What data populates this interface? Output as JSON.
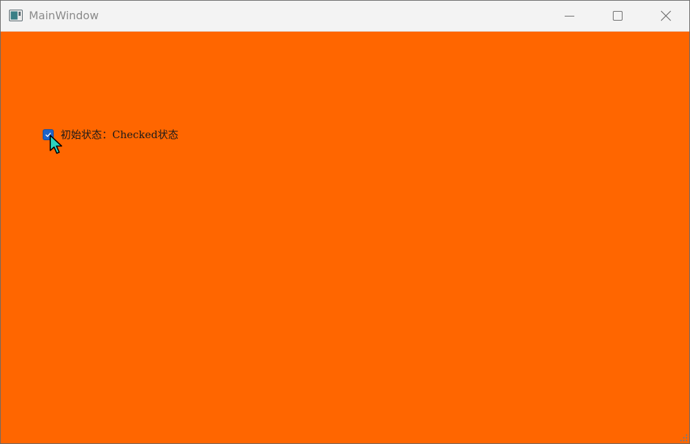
{
  "window": {
    "title": "MainWindow",
    "app_icon": "qt-window-icon",
    "controls": {
      "minimize_icon": "minimize-icon",
      "maximize_icon": "maximize-icon",
      "close_icon": "close-icon"
    }
  },
  "client": {
    "background_color": "#ff6600",
    "checkbox": {
      "label": "初始状态：Checked状态",
      "checked": true,
      "accent_color": "#1f64c8"
    }
  }
}
